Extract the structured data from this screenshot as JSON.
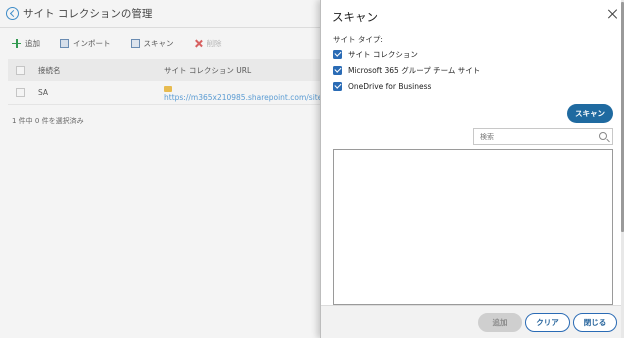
{
  "background": {
    "page_title": "サイト コレクションの管理",
    "toolbar": {
      "add": "追加",
      "import": "インポート",
      "scan": "スキャン",
      "delete": "削除"
    },
    "table": {
      "headers": [
        "接続名",
        "サイト コレクション URL"
      ],
      "rows": [
        {
          "name": "SA",
          "url": "https://m365x210985.sharepoint.com/sites"
        }
      ]
    },
    "selection_status": "1 件中 0 件を選択済み"
  },
  "dialog": {
    "title": "スキャン",
    "site_type_label": "サイト タイプ:",
    "site_types": [
      {
        "label": "サイト コレクション",
        "checked": true
      },
      {
        "label": "Microsoft 365 グループ チーム サイト",
        "checked": true
      },
      {
        "label": "OneDrive for Business",
        "checked": true
      }
    ],
    "scan_button": "スキャン",
    "search": {
      "placeholder": "検索",
      "value": ""
    },
    "footer": {
      "add": "追加",
      "clear": "クリア",
      "close": "閉じる"
    }
  },
  "colors": {
    "primary_button": "#1f6aa0",
    "checkbox": "#2a6bb5",
    "link": "#5aa0dc",
    "disabled_button": "#cfcfcf"
  }
}
